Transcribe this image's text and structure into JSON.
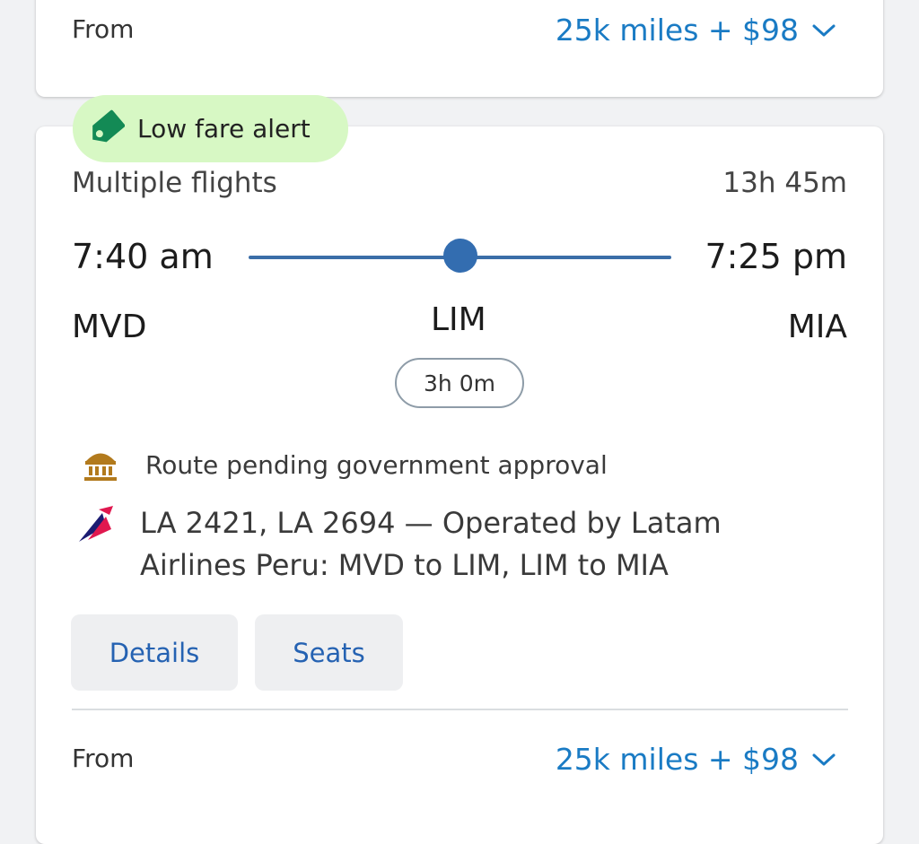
{
  "top_card": {
    "from_label": "From",
    "price": "25k miles + $98",
    "chevron_icon": "chevron-down-icon"
  },
  "flight_card": {
    "badge": {
      "label": "Low fare alert",
      "icon": "tag-icon",
      "background": "#d7f8c4",
      "icon_color": "#138a55"
    },
    "flights_label": "Multiple flights",
    "total_duration": "13h 45m",
    "departure": {
      "time": "7:40 am",
      "airport": "MVD"
    },
    "arrival": {
      "time": "7:25 pm",
      "airport": "MIA"
    },
    "stop": {
      "airport": "LIM",
      "layover": "3h 0m"
    },
    "notice": {
      "icon": "government-building-icon",
      "text": "Route pending government approval",
      "icon_color": "#b27a1d"
    },
    "operated_by": {
      "airline_logo": "latam-logo-icon",
      "text": "LA 2421, LA 2694 — Operated by Latam Airlines Peru: MVD to LIM, LIM to MIA"
    },
    "buttons": {
      "details": "Details",
      "seats": "Seats"
    },
    "from_label": "From",
    "price": "25k miles + $98",
    "chevron_icon": "chevron-down-icon"
  },
  "colors": {
    "accent_link": "#1a7bc4",
    "button_text": "#2562b2",
    "route_line": "#3b6ea8"
  }
}
